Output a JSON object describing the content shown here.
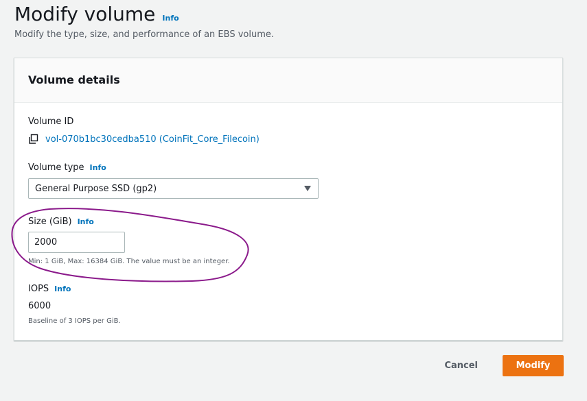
{
  "header": {
    "title": "Modify volume",
    "info_label": "Info",
    "description": "Modify the type, size, and performance of an EBS volume."
  },
  "panel": {
    "title": "Volume details",
    "volume_id": {
      "label": "Volume ID",
      "value": "vol-070b1bc30cedba510 (CoinFit_Core_Filecoin)",
      "icon": "copy-icon"
    },
    "volume_type": {
      "label": "Volume type",
      "info_label": "Info",
      "selected": "General Purpose SSD (gp2)"
    },
    "size": {
      "label": "Size (GiB)",
      "info_label": "Info",
      "value": "2000",
      "hint": "Min: 1 GiB, Max: 16384 GiB. The value must be an integer."
    },
    "iops": {
      "label": "IOPS",
      "info_label": "Info",
      "value": "6000",
      "hint": "Baseline of 3 IOPS per GiB."
    }
  },
  "actions": {
    "cancel_label": "Cancel",
    "modify_label": "Modify"
  },
  "colors": {
    "accent": "#ec7211",
    "link": "#0073bb",
    "annotation": "#8b1a8b"
  }
}
